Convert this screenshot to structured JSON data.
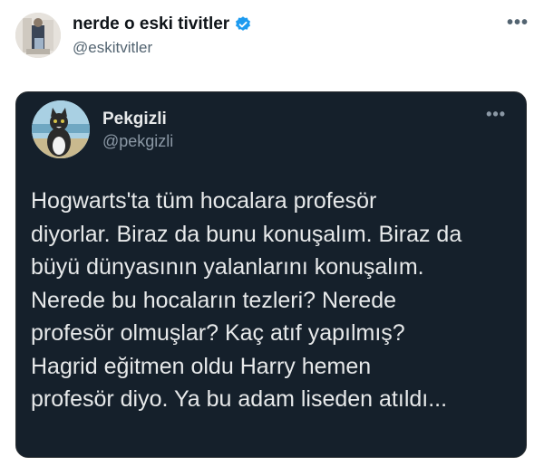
{
  "outer": {
    "display_name": "nerde o eski tivitler",
    "handle": "@eskitvitler",
    "verified": true,
    "more_icon": "•••"
  },
  "quoted": {
    "display_name": "Pekgizli",
    "handle": "@pekgizli",
    "more_icon": "•••",
    "text": "Hogwarts'ta tüm hocalara profesör\ndiyorlar. Biraz da bunu konuşalım. Biraz da\nbüyü dünyasının yalanlarını konuşalım.\nNerede bu hocaların tezleri? Nerede\nprofesör olmuşlar? Kaç atıf yapılmış?\nHagrid eğitmen oldu Harry hemen\nprofesör diyo. Ya bu adam liseden atıldı..."
  },
  "colors": {
    "verified_badge": "#1d9bf0",
    "card_background": "#15202b"
  }
}
